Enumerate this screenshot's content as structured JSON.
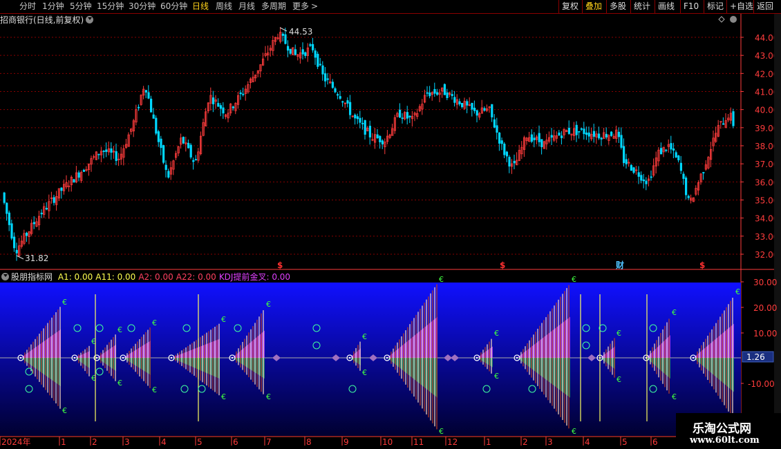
{
  "toolbar": {
    "periods": [
      "分时",
      "1分钟",
      "5分钟",
      "15分钟",
      "30分钟",
      "60分钟",
      "日线",
      "周线",
      "月线",
      "多周期",
      "更多"
    ],
    "active_period": "日线",
    "more_arrow": ">",
    "buttons": [
      "复权",
      "叠加",
      "多股",
      "统计",
      "画线",
      "F10",
      "标记",
      "+自选",
      "返回"
    ],
    "active_button": "叠加"
  },
  "main_chart": {
    "title": "招商银行(日线,前复权)",
    "y_ticks": [
      "44.00",
      "43.00",
      "42.00",
      "41.00",
      "40.00",
      "39.00",
      "38.00",
      "37.00",
      "36.00",
      "35.00",
      "34.00",
      "33.00",
      "32.00"
    ],
    "high_label": "44.53",
    "low_label": "31.82",
    "markers": [
      {
        "text": "$",
        "color": "#ff3030"
      },
      {
        "text": "$",
        "color": "#ff3030"
      },
      {
        "text": "财",
        "color": "#4fc3ff"
      },
      {
        "text": "$",
        "color": "#ff3030"
      }
    ]
  },
  "indicator": {
    "name": "股朋指标网",
    "values": [
      {
        "label": "A1:",
        "value": "0.00",
        "color": "#ffff50"
      },
      {
        "label": "A11:",
        "value": "0.00",
        "color": "#ffff50"
      },
      {
        "label": "A2:",
        "value": "0.00",
        "color": "#ff4060"
      },
      {
        "label": "A22:",
        "value": "0.00",
        "color": "#ff4060"
      },
      {
        "label": "KDJ提前金叉:",
        "value": "0.00",
        "color": "#e040ff"
      }
    ],
    "y_ticks": [
      "30.00",
      "20.00",
      "10.00",
      "-10.00"
    ],
    "current_value": "1.26"
  },
  "time_axis": {
    "labels": [
      "2024年",
      "1",
      "2",
      "3",
      "4",
      "5",
      "6",
      "7",
      "8",
      "9",
      "10",
      "11",
      "12",
      "1",
      "2",
      "3",
      "4",
      "5",
      "6"
    ]
  },
  "watermark": {
    "line1": "乐淘公式网",
    "line2": "www.60lt.com"
  },
  "colors": {
    "up": "#ff3c3c",
    "down": "#00d7ff",
    "grid": "#8b0000",
    "axis": "#ff3c3c",
    "indicator_bg_top": "#1010ff",
    "indicator_bg_bottom": "#000030"
  }
}
